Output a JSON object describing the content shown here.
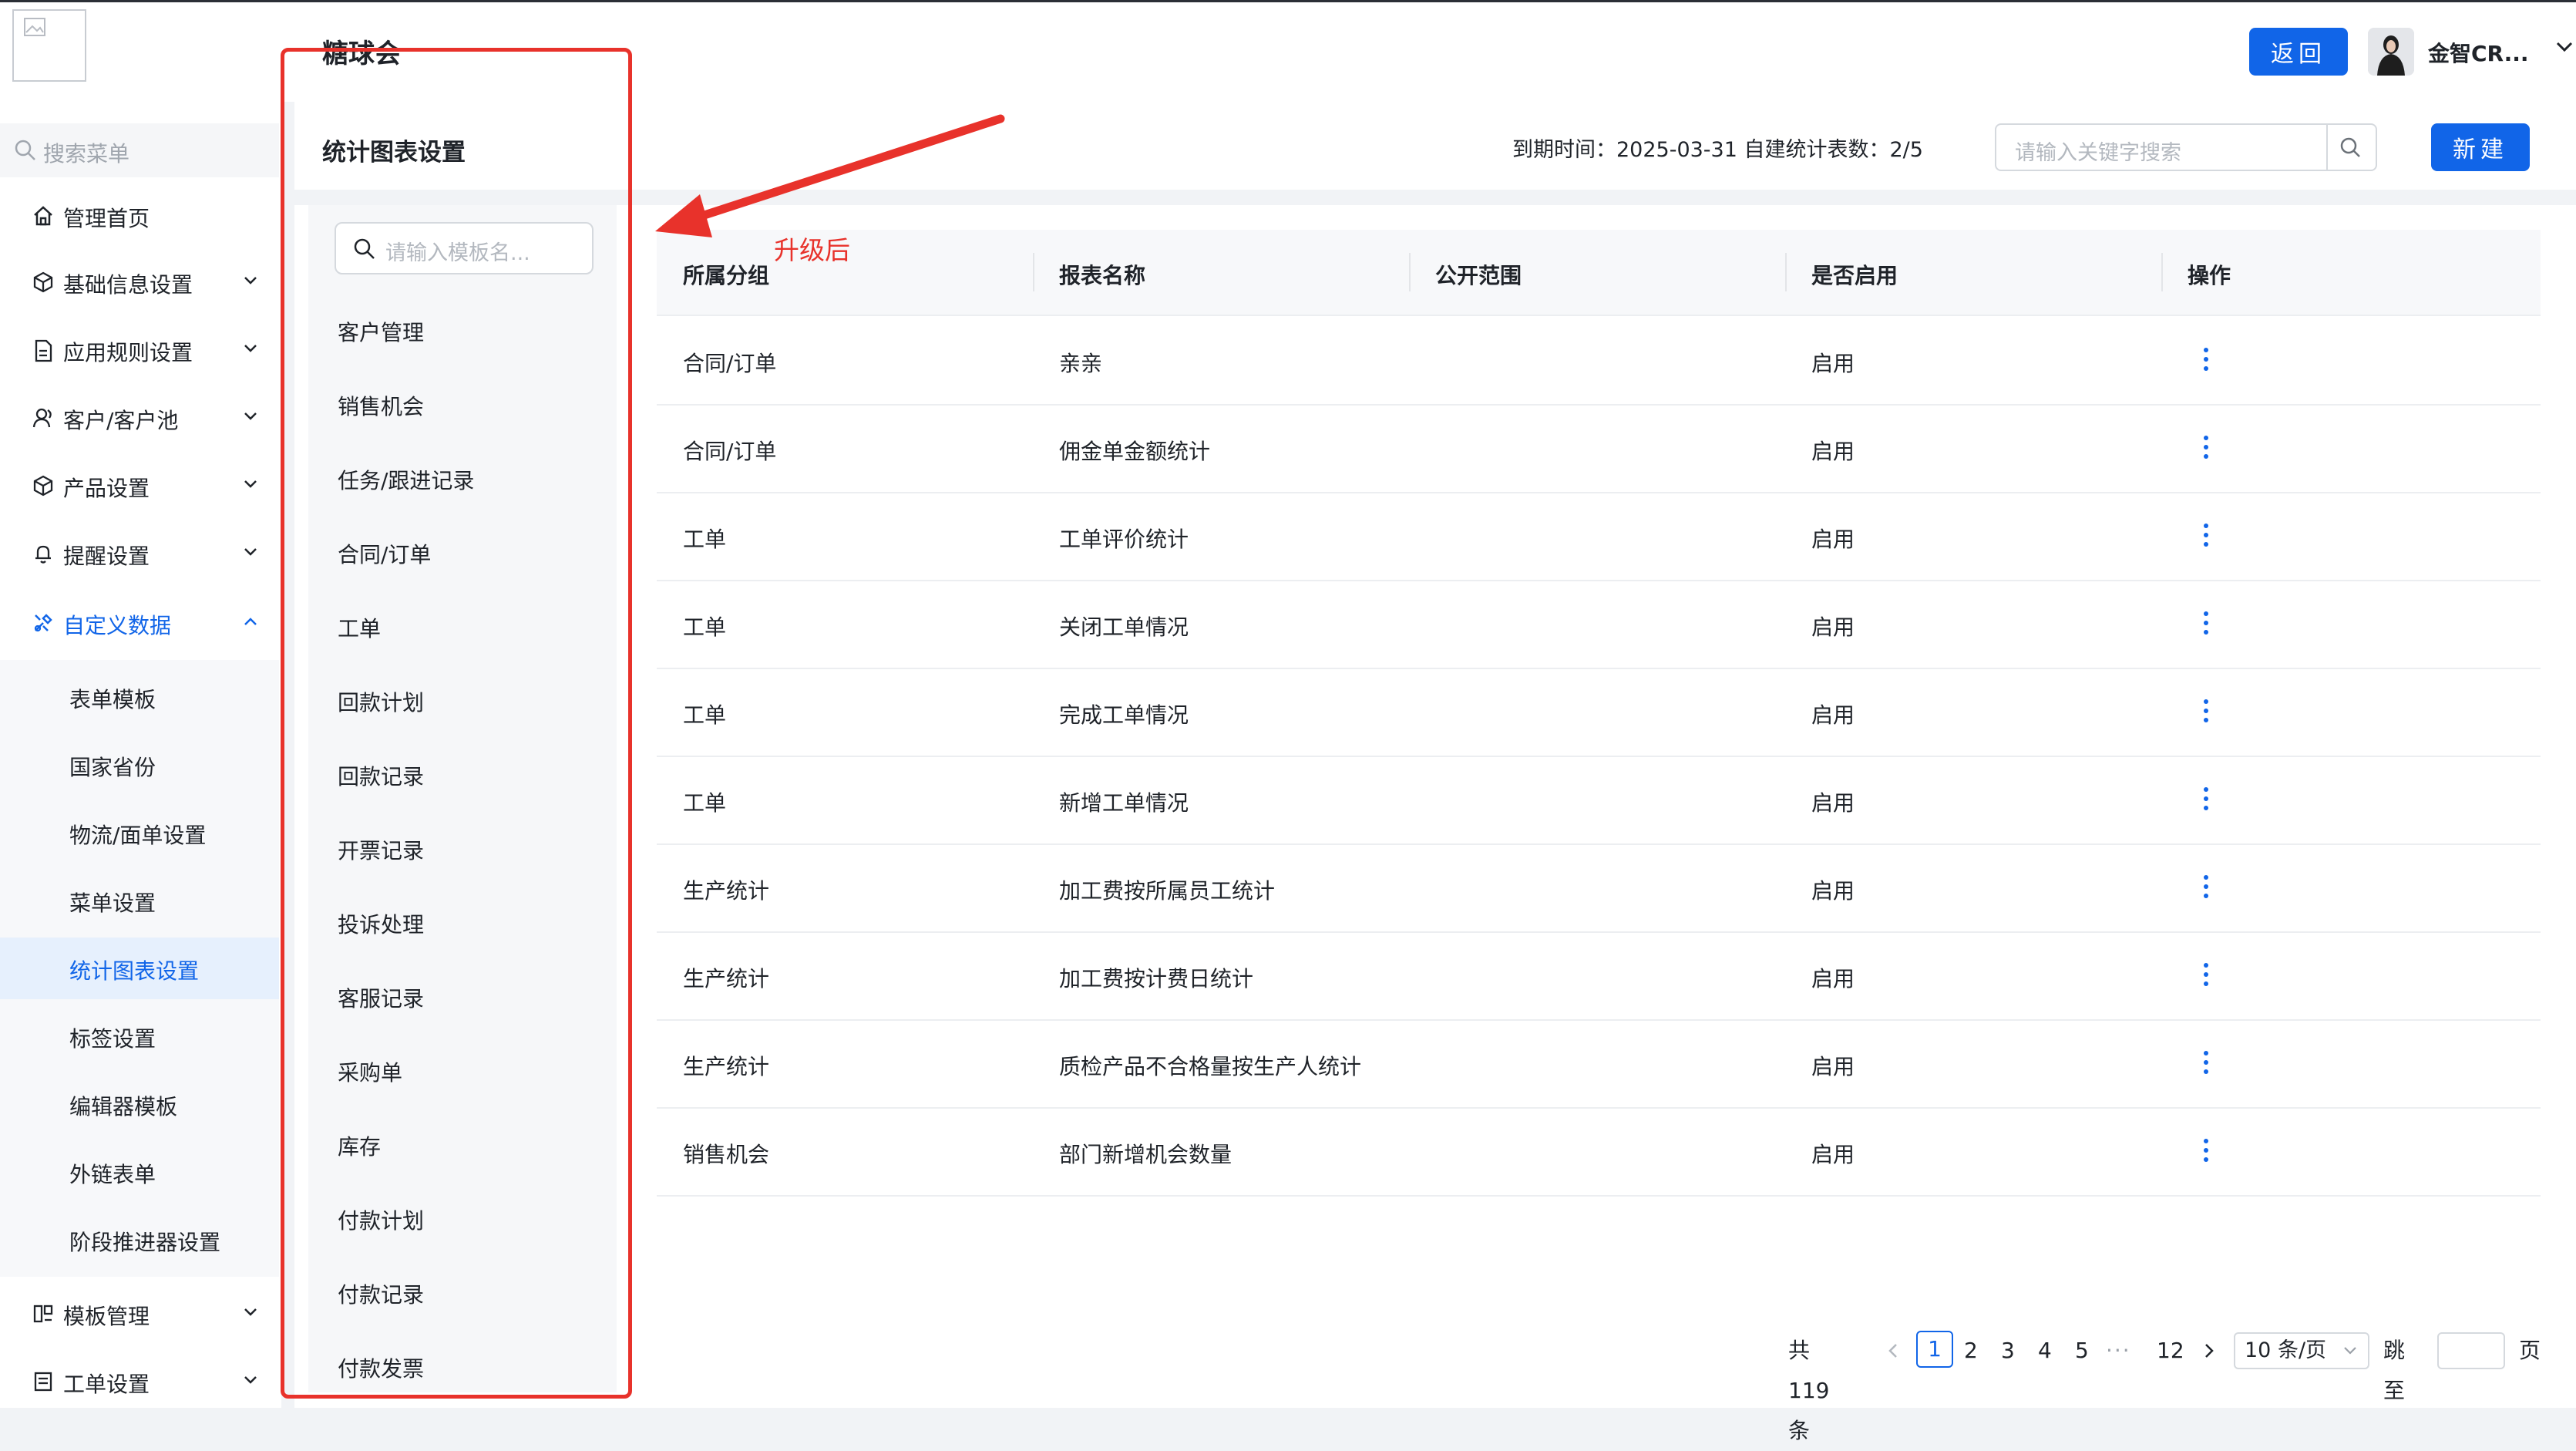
{
  "header": {
    "app_title": "糖球会",
    "back_button": "返回",
    "user_name": "金智CR..."
  },
  "sidebar": {
    "search_placeholder": "搜索菜单",
    "items": [
      {
        "label": "管理首页",
        "icon": "home-icon",
        "has_children": false
      },
      {
        "label": "基础信息设置",
        "icon": "cube-icon",
        "has_children": true
      },
      {
        "label": "应用规则设置",
        "icon": "document-icon",
        "has_children": true
      },
      {
        "label": "客户/客户池",
        "icon": "user-icon",
        "has_children": true
      },
      {
        "label": "产品设置",
        "icon": "cube-icon",
        "has_children": true
      },
      {
        "label": "提醒设置",
        "icon": "bell-icon",
        "has_children": true
      },
      {
        "label": "自定义数据",
        "icon": "tools-icon",
        "has_children": true,
        "expanded": true
      }
    ],
    "sub_items": [
      "表单模板",
      "国家省份",
      "物流/面单设置",
      "菜单设置",
      "统计图表设置",
      "标签设置",
      "编辑器模板",
      "外链表单",
      "阶段推进器设置"
    ],
    "selected_sub_item": "统计图表设置",
    "bottom_items": [
      {
        "label": "模板管理",
        "icon": "layout-icon",
        "has_children": true
      },
      {
        "label": "工单设置",
        "icon": "list-icon",
        "has_children": true
      }
    ],
    "accent_color": "#1165e8"
  },
  "content": {
    "section_title": "统计图表设置",
    "expiry_text": "到期时间：2025-03-31  自建统计表数：2/5",
    "keyword_search_placeholder": "请输入关键字搜索",
    "new_button": "新建"
  },
  "template_panel": {
    "search_placeholder": "请输入模板名...",
    "items": [
      "客户管理",
      "销售机会",
      "任务/跟进记录",
      "合同/订单",
      "工单",
      "回款计划",
      "回款记录",
      "开票记录",
      "投诉处理",
      "客服记录",
      "采购单",
      "库存",
      "付款计划",
      "付款记录",
      "付款发票"
    ]
  },
  "table": {
    "columns": [
      "所属分组",
      "报表名称",
      "公开范围",
      "是否启用",
      "操作"
    ],
    "rows": [
      {
        "group": "合同/订单",
        "name": "亲亲",
        "scope": "",
        "enabled": "启用"
      },
      {
        "group": "合同/订单",
        "name": "佣金单金额统计",
        "scope": "",
        "enabled": "启用"
      },
      {
        "group": "工单",
        "name": "工单评价统计",
        "scope": "",
        "enabled": "启用"
      },
      {
        "group": "工单",
        "name": "关闭工单情况",
        "scope": "",
        "enabled": "启用"
      },
      {
        "group": "工单",
        "name": "完成工单情况",
        "scope": "",
        "enabled": "启用"
      },
      {
        "group": "工单",
        "name": "新增工单情况",
        "scope": "",
        "enabled": "启用"
      },
      {
        "group": "生产统计",
        "name": "加工费按所属员工统计",
        "scope": "",
        "enabled": "启用"
      },
      {
        "group": "生产统计",
        "name": "加工费按计费日统计",
        "scope": "",
        "enabled": "启用"
      },
      {
        "group": "生产统计",
        "name": "质检产品不合格量按生产人统计",
        "scope": "",
        "enabled": "启用"
      },
      {
        "group": "销售机会",
        "name": "部门新增机会数量",
        "scope": "",
        "enabled": "启用"
      }
    ]
  },
  "pagination": {
    "total": "共119条",
    "current_page": "1",
    "pages": [
      "2",
      "3",
      "4",
      "5"
    ],
    "ellipsis": "···",
    "last_page": "12",
    "page_size": "10 条/页",
    "jump_label": "跳至",
    "page_suffix": "页"
  },
  "annotation": {
    "label": "升级后",
    "color": "#e8322b"
  }
}
